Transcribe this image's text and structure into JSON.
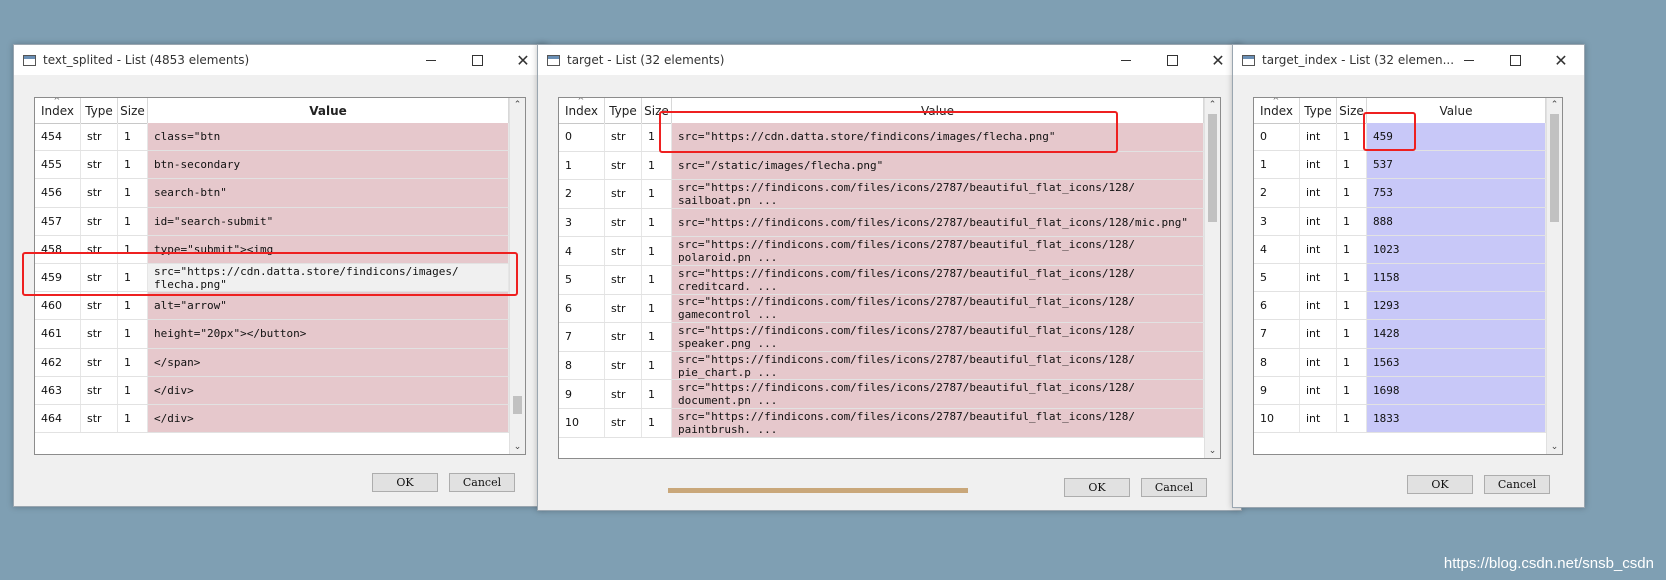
{
  "windows": [
    {
      "title": "text_splited - List (4853 elements)",
      "columns": [
        "Index",
        "Type",
        "Size",
        "Value"
      ],
      "rows": [
        {
          "index": "454",
          "type": "str",
          "size": "1",
          "value": "class=\"btn"
        },
        {
          "index": "455",
          "type": "str",
          "size": "1",
          "value": "btn-secondary"
        },
        {
          "index": "456",
          "type": "str",
          "size": "1",
          "value": "search-btn\""
        },
        {
          "index": "457",
          "type": "str",
          "size": "1",
          "value": "id=\"search-submit\""
        },
        {
          "index": "458",
          "type": "str",
          "size": "1",
          "value": "type=\"submit\"><img"
        },
        {
          "index": "459",
          "type": "str",
          "size": "1",
          "value": "src=\"https://cdn.datta.store/findicons/images/\nflecha.png\""
        },
        {
          "index": "460",
          "type": "str",
          "size": "1",
          "value": "alt=\"arrow\""
        },
        {
          "index": "461",
          "type": "str",
          "size": "1",
          "value": "height=\"20px\"></button>"
        },
        {
          "index": "462",
          "type": "str",
          "size": "1",
          "value": "</span>"
        },
        {
          "index": "463",
          "type": "str",
          "size": "1",
          "value": "</div>"
        },
        {
          "index": "464",
          "type": "str",
          "size": "1",
          "value": "</div>"
        }
      ],
      "ok_label": "OK",
      "cancel_label": "Cancel"
    },
    {
      "title": "target - List (32 elements)",
      "columns": [
        "Index",
        "Type",
        "Size",
        "Value"
      ],
      "rows": [
        {
          "index": "0",
          "type": "str",
          "size": "1",
          "value": "src=\"https://cdn.datta.store/findicons/images/flecha.png\""
        },
        {
          "index": "1",
          "type": "str",
          "size": "1",
          "value": "src=\"/static/images/flecha.png\""
        },
        {
          "index": "2",
          "type": "str",
          "size": "1",
          "value": "src=\"https://findicons.com/files/icons/2787/beautiful_flat_icons/128/\nsailboat.pn ..."
        },
        {
          "index": "3",
          "type": "str",
          "size": "1",
          "value": "src=\"https://findicons.com/files/icons/2787/beautiful_flat_icons/128/mic.png\""
        },
        {
          "index": "4",
          "type": "str",
          "size": "1",
          "value": "src=\"https://findicons.com/files/icons/2787/beautiful_flat_icons/128/\npolaroid.pn ..."
        },
        {
          "index": "5",
          "type": "str",
          "size": "1",
          "value": "src=\"https://findicons.com/files/icons/2787/beautiful_flat_icons/128/\ncreditcard. ..."
        },
        {
          "index": "6",
          "type": "str",
          "size": "1",
          "value": "src=\"https://findicons.com/files/icons/2787/beautiful_flat_icons/128/\ngamecontrol ..."
        },
        {
          "index": "7",
          "type": "str",
          "size": "1",
          "value": "src=\"https://findicons.com/files/icons/2787/beautiful_flat_icons/128/\nspeaker.png ..."
        },
        {
          "index": "8",
          "type": "str",
          "size": "1",
          "value": "src=\"https://findicons.com/files/icons/2787/beautiful_flat_icons/128/\npie_chart.p ..."
        },
        {
          "index": "9",
          "type": "str",
          "size": "1",
          "value": "src=\"https://findicons.com/files/icons/2787/beautiful_flat_icons/128/\ndocument.pn ..."
        },
        {
          "index": "10",
          "type": "str",
          "size": "1",
          "value": "src=\"https://findicons.com/files/icons/2787/beautiful_flat_icons/128/\npaintbrush. ..."
        }
      ],
      "ok_label": "OK",
      "cancel_label": "Cancel"
    },
    {
      "title": "target_index - List (32 elemen...",
      "columns": [
        "Index",
        "Type",
        "Size",
        "Value"
      ],
      "rows": [
        {
          "index": "0",
          "type": "int",
          "size": "1",
          "value": "459"
        },
        {
          "index": "1",
          "type": "int",
          "size": "1",
          "value": "537"
        },
        {
          "index": "2",
          "type": "int",
          "size": "1",
          "value": "753"
        },
        {
          "index": "3",
          "type": "int",
          "size": "1",
          "value": "888"
        },
        {
          "index": "4",
          "type": "int",
          "size": "1",
          "value": "1023"
        },
        {
          "index": "5",
          "type": "int",
          "size": "1",
          "value": "1158"
        },
        {
          "index": "6",
          "type": "int",
          "size": "1",
          "value": "1293"
        },
        {
          "index": "7",
          "type": "int",
          "size": "1",
          "value": "1428"
        },
        {
          "index": "8",
          "type": "int",
          "size": "1",
          "value": "1563"
        },
        {
          "index": "9",
          "type": "int",
          "size": "1",
          "value": "1698"
        },
        {
          "index": "10",
          "type": "int",
          "size": "1",
          "value": "1833"
        }
      ],
      "ok_label": "OK",
      "cancel_label": "Cancel"
    }
  ],
  "watermark": "https://blog.csdn.net/snsb_csdn",
  "colors": {
    "desktop": "#7f9fb3",
    "str_value_bg": "#e6c8cc",
    "int_value_bg": "#c8c8f8",
    "highlight": "#ee2020"
  }
}
